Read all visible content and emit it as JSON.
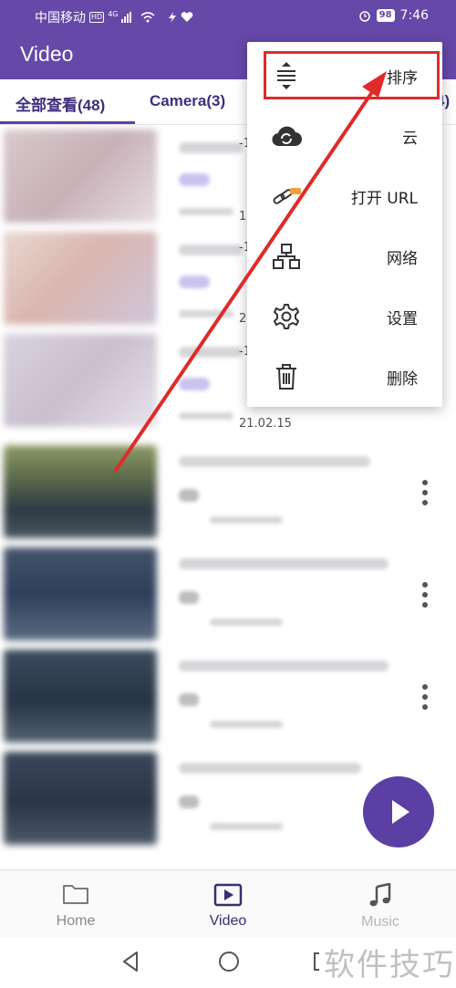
{
  "status_bar": {
    "carrier": "中国移动",
    "hd_badge": "HD",
    "network": "4G",
    "battery": "98",
    "time": "7:46"
  },
  "app_bar": {
    "title": "Video"
  },
  "tabs": [
    {
      "label": "全部查看(48)"
    },
    {
      "label": "Camera(3)"
    },
    {
      "label": "4)"
    }
  ],
  "list": {
    "fragments": [
      "-1",
      "1",
      "-1",
      "2",
      "-1"
    ],
    "date_fragment": "21.02.15"
  },
  "menu": {
    "items": [
      {
        "label": "排序",
        "icon": "sort-icon"
      },
      {
        "label": "云",
        "icon": "cloud-sync-icon"
      },
      {
        "label": "打开 URL",
        "icon": "link-icon"
      },
      {
        "label": "网络",
        "icon": "network-icon"
      },
      {
        "label": "设置",
        "icon": "gear-icon"
      },
      {
        "label": "删除",
        "icon": "trash-icon"
      }
    ]
  },
  "bottom_nav": {
    "items": [
      {
        "label": "Home",
        "icon": "folder-icon"
      },
      {
        "label": "Video",
        "icon": "video-play-icon"
      },
      {
        "label": "Music",
        "icon": "music-note-icon"
      }
    ]
  },
  "watermark": "软件技巧",
  "colors": {
    "primary": "#6548a8",
    "tab_text": "#3f2d7e",
    "fab": "#5b3fa3",
    "annotation_red": "#e02a2a"
  }
}
